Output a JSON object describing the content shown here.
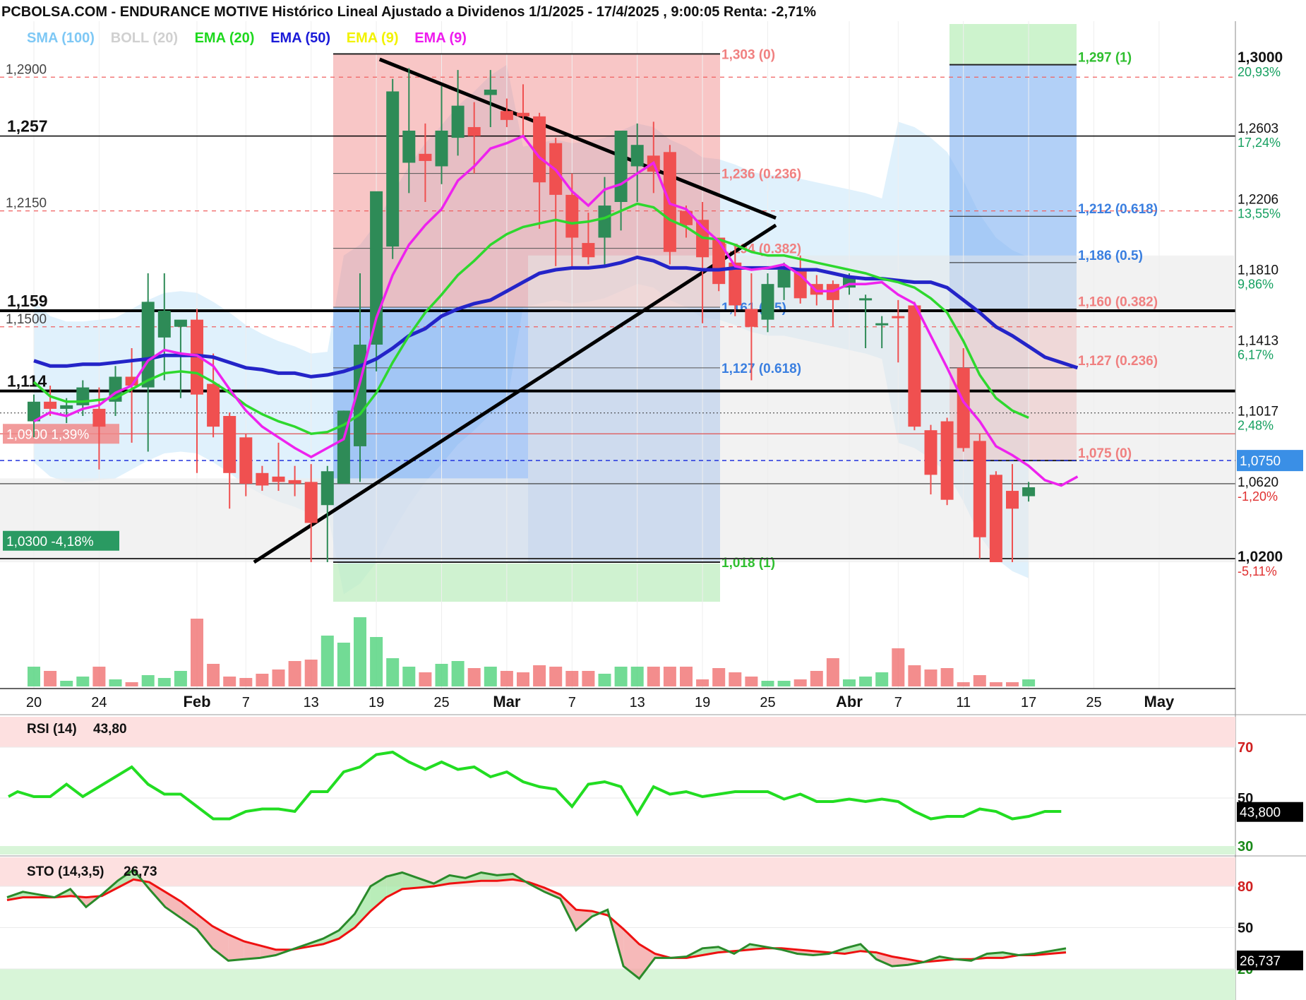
{
  "header": {
    "title": "PCBOLSA.COM - ENDURANCE MOTIVE Histórico Lineal Ajustado a Dividenos 1/1/2025 - 17/4/2025 , 9:00:05 Renta: -2,71%"
  },
  "legend": [
    {
      "label": "SMA (100)",
      "color": "#7ec8f5"
    },
    {
      "label": "BOLL (20)",
      "color": "#d0d0d0"
    },
    {
      "label": "EMA (20)",
      "color": "#1ed81e"
    },
    {
      "label": "EMA (50)",
      "color": "#1a1ad8"
    },
    {
      "label": "EMA (9)",
      "color": "#f2f200"
    },
    {
      "label": "EMA (9)",
      "color": "#ee1aee"
    }
  ],
  "chart_data": [
    {
      "type": "candlestick",
      "title": "ENDURANCE MOTIVE",
      "price_axis": [
        {
          "price": 1.3,
          "label": "1,3000",
          "pct": "20,93%"
        },
        {
          "price": 1.2603,
          "label": "1,2603",
          "pct": "17,24%"
        },
        {
          "price": 1.2206,
          "label": "1,2206",
          "pct": "13,55%"
        },
        {
          "price": 1.181,
          "label": "1,1810",
          "pct": "9,86%"
        },
        {
          "price": 1.1413,
          "label": "1,1413",
          "pct": "6,17%"
        },
        {
          "price": 1.1017,
          "label": "1,1017",
          "pct": "2,48%"
        },
        {
          "price": 1.062,
          "label": "1,0620",
          "pct": "-1,20%"
        },
        {
          "price": 1.02,
          "label": "1,0200",
          "pct": "-5,11%"
        }
      ],
      "current_price": {
        "value": 1.075,
        "label": "1,0750"
      },
      "x_axis": [
        {
          "idx": 0,
          "label": "20"
        },
        {
          "idx": 4,
          "label": "24"
        },
        {
          "idx": 10,
          "label": "Feb",
          "bold": true
        },
        {
          "idx": 13,
          "label": "7"
        },
        {
          "idx": 17,
          "label": "13"
        },
        {
          "idx": 21,
          "label": "19"
        },
        {
          "idx": 25,
          "label": "25"
        },
        {
          "idx": 29,
          "label": "Mar",
          "bold": true
        },
        {
          "idx": 33,
          "label": "7"
        },
        {
          "idx": 37,
          "label": "13"
        },
        {
          "idx": 41,
          "label": "19"
        },
        {
          "idx": 45,
          "label": "25"
        },
        {
          "idx": 50,
          "label": "Abr",
          "bold": true
        },
        {
          "idx": 53,
          "label": "7"
        },
        {
          "idx": 57,
          "label": "11"
        },
        {
          "idx": 61,
          "label": "17"
        },
        {
          "idx": 65,
          "label": "25"
        },
        {
          "idx": 69,
          "label": "May",
          "bold": true
        }
      ],
      "candles": [
        {
          "o": 1.097,
          "h": 1.112,
          "l": 1.088,
          "c": 1.108
        },
        {
          "o": 1.108,
          "h": 1.117,
          "l": 1.1,
          "c": 1.104
        },
        {
          "o": 1.104,
          "h": 1.11,
          "l": 1.096,
          "c": 1.106
        },
        {
          "o": 1.106,
          "h": 1.12,
          "l": 1.1,
          "c": 1.116
        },
        {
          "o": 1.104,
          "h": 1.116,
          "l": 1.07,
          "c": 1.094
        },
        {
          "o": 1.108,
          "h": 1.128,
          "l": 1.1,
          "c": 1.122
        },
        {
          "o": 1.122,
          "h": 1.138,
          "l": 1.085,
          "c": 1.117
        },
        {
          "o": 1.116,
          "h": 1.18,
          "l": 1.08,
          "c": 1.164
        },
        {
          "o": 1.144,
          "h": 1.18,
          "l": 1.12,
          "c": 1.159
        },
        {
          "o": 1.15,
          "h": 1.152,
          "l": 1.11,
          "c": 1.154
        },
        {
          "o": 1.154,
          "h": 1.16,
          "l": 1.068,
          "c": 1.112
        },
        {
          "o": 1.118,
          "h": 1.135,
          "l": 1.088,
          "c": 1.094
        },
        {
          "o": 1.1,
          "h": 1.102,
          "l": 1.048,
          "c": 1.068
        },
        {
          "o": 1.088,
          "h": 1.09,
          "l": 1.055,
          "c": 1.062
        },
        {
          "o": 1.068,
          "h": 1.072,
          "l": 1.058,
          "c": 1.061
        },
        {
          "o": 1.066,
          "h": 1.085,
          "l": 1.058,
          "c": 1.063
        },
        {
          "o": 1.064,
          "h": 1.072,
          "l": 1.055,
          "c": 1.062
        },
        {
          "o": 1.063,
          "h": 1.073,
          "l": 1.018,
          "c": 1.04
        },
        {
          "o": 1.05,
          "h": 1.072,
          "l": 1.018,
          "c": 1.069
        },
        {
          "o": 1.062,
          "h": 1.103,
          "l": 1.062,
          "c": 1.103
        },
        {
          "o": 1.083,
          "h": 1.18,
          "l": 1.063,
          "c": 1.14
        },
        {
          "o": 1.14,
          "h": 1.21,
          "l": 1.125,
          "c": 1.226
        },
        {
          "o": 1.195,
          "h": 1.289,
          "l": 1.188,
          "c": 1.282
        },
        {
          "o": 1.242,
          "h": 1.295,
          "l": 1.225,
          "c": 1.26
        },
        {
          "o": 1.247,
          "h": 1.264,
          "l": 1.22,
          "c": 1.243
        },
        {
          "o": 1.24,
          "h": 1.285,
          "l": 1.23,
          "c": 1.26
        },
        {
          "o": 1.256,
          "h": 1.294,
          "l": 1.246,
          "c": 1.274
        },
        {
          "o": 1.262,
          "h": 1.276,
          "l": 1.236,
          "c": 1.257
        },
        {
          "o": 1.28,
          "h": 1.294,
          "l": 1.262,
          "c": 1.283
        },
        {
          "o": 1.271,
          "h": 1.278,
          "l": 1.262,
          "c": 1.266
        },
        {
          "o": 1.27,
          "h": 1.286,
          "l": 1.256,
          "c": 1.268
        },
        {
          "o": 1.268,
          "h": 1.27,
          "l": 1.205,
          "c": 1.231
        },
        {
          "o": 1.253,
          "h": 1.256,
          "l": 1.184,
          "c": 1.224
        },
        {
          "o": 1.224,
          "h": 1.236,
          "l": 1.183,
          "c": 1.2
        },
        {
          "o": 1.197,
          "h": 1.214,
          "l": 1.185,
          "c": 1.189
        },
        {
          "o": 1.2,
          "h": 1.234,
          "l": 1.184,
          "c": 1.218
        },
        {
          "o": 1.22,
          "h": 1.242,
          "l": 1.204,
          "c": 1.26
        },
        {
          "o": 1.24,
          "h": 1.264,
          "l": 1.22,
          "c": 1.252
        },
        {
          "o": 1.246,
          "h": 1.265,
          "l": 1.225,
          "c": 1.237
        },
        {
          "o": 1.248,
          "h": 1.252,
          "l": 1.185,
          "c": 1.192
        },
        {
          "o": 1.215,
          "h": 1.218,
          "l": 1.2,
          "c": 1.207
        },
        {
          "o": 1.21,
          "h": 1.22,
          "l": 1.152,
          "c": 1.189
        },
        {
          "o": 1.2,
          "h": 1.2,
          "l": 1.17,
          "c": 1.174
        },
        {
          "o": 1.186,
          "h": 1.196,
          "l": 1.156,
          "c": 1.162
        },
        {
          "o": 1.16,
          "h": 1.18,
          "l": 1.12,
          "c": 1.15
        },
        {
          "o": 1.154,
          "h": 1.18,
          "l": 1.147,
          "c": 1.174
        },
        {
          "o": 1.172,
          "h": 1.186,
          "l": 1.165,
          "c": 1.182
        },
        {
          "o": 1.182,
          "h": 1.19,
          "l": 1.163,
          "c": 1.166
        },
        {
          "o": 1.174,
          "h": 1.179,
          "l": 1.162,
          "c": 1.168
        },
        {
          "o": 1.174,
          "h": 1.176,
          "l": 1.15,
          "c": 1.165
        },
        {
          "o": 1.172,
          "h": 1.18,
          "l": 1.168,
          "c": 1.178
        },
        {
          "o": 1.165,
          "h": 1.168,
          "l": 1.138,
          "c": 1.166
        },
        {
          "o": 1.152,
          "h": 1.156,
          "l": 1.138,
          "c": 1.152
        },
        {
          "o": 1.156,
          "h": 1.165,
          "l": 1.13,
          "c": 1.155
        },
        {
          "o": 1.162,
          "h": 1.164,
          "l": 1.092,
          "c": 1.094
        },
        {
          "o": 1.092,
          "h": 1.095,
          "l": 1.056,
          "c": 1.067
        },
        {
          "o": 1.097,
          "h": 1.099,
          "l": 1.05,
          "c": 1.053
        },
        {
          "o": 1.127,
          "h": 1.138,
          "l": 1.08,
          "c": 1.082
        },
        {
          "o": 1.086,
          "h": 1.09,
          "l": 1.02,
          "c": 1.032
        },
        {
          "o": 1.067,
          "h": 1.069,
          "l": 1.018,
          "c": 1.018
        },
        {
          "o": 1.058,
          "h": 1.073,
          "l": 1.018,
          "c": 1.048
        },
        {
          "o": 1.055,
          "h": 1.063,
          "l": 1.052,
          "c": 1.06
        }
      ],
      "volumes": [
        28,
        22,
        8,
        14,
        28,
        10,
        6,
        16,
        12,
        22,
        96,
        32,
        14,
        12,
        18,
        24,
        36,
        38,
        72,
        62,
        98,
        70,
        40,
        28,
        20,
        32,
        36,
        26,
        28,
        22,
        20,
        30,
        28,
        22,
        22,
        18,
        28,
        28,
        28,
        28,
        28,
        10,
        26,
        20,
        14,
        8,
        8,
        10,
        22,
        40,
        10,
        14,
        20,
        54,
        30,
        24,
        26,
        6,
        16,
        6,
        6,
        10
      ],
      "ema20": [
        1.119,
        1.111,
        1.108,
        1.108,
        1.109,
        1.11,
        1.115,
        1.12,
        1.124,
        1.125,
        1.124,
        1.119,
        1.113,
        1.106,
        1.101,
        1.097,
        1.094,
        1.09,
        1.091,
        1.095,
        1.101,
        1.113,
        1.13,
        1.145,
        1.158,
        1.168,
        1.179,
        1.187,
        1.196,
        1.202,
        1.206,
        1.208,
        1.21,
        1.208,
        1.209,
        1.211,
        1.215,
        1.219,
        1.217,
        1.21,
        1.206,
        1.2,
        1.199,
        1.196,
        1.192,
        1.19,
        1.19,
        1.188,
        1.186,
        1.184,
        1.182,
        1.18,
        1.177,
        1.175,
        1.172,
        1.166,
        1.158,
        1.142,
        1.123,
        1.11,
        1.103,
        1.099
      ],
      "ema50": [
        1.131,
        1.128,
        1.128,
        1.129,
        1.129,
        1.13,
        1.131,
        1.132,
        1.134,
        1.134,
        1.134,
        1.133,
        1.13,
        1.127,
        1.126,
        1.124,
        1.124,
        1.122,
        1.123,
        1.125,
        1.128,
        1.132,
        1.138,
        1.145,
        1.149,
        1.156,
        1.16,
        1.163,
        1.165,
        1.17,
        1.175,
        1.18,
        1.182,
        1.183,
        1.183,
        1.184,
        1.186,
        1.189,
        1.187,
        1.183,
        1.183,
        1.182,
        1.182,
        1.183,
        1.183,
        1.183,
        1.183,
        1.182,
        1.182,
        1.18,
        1.178,
        1.177,
        1.177,
        1.176,
        1.175,
        1.175,
        1.172,
        1.165,
        1.158,
        1.15,
        1.145,
        1.139,
        1.133,
        1.13,
        1.127
      ],
      "ema9": [
        1.097,
        1.102,
        1.1,
        1.104,
        1.106,
        1.113,
        1.117,
        1.131,
        1.137,
        1.135,
        1.134,
        1.128,
        1.115,
        1.103,
        1.094,
        1.088,
        1.082,
        1.077,
        1.082,
        1.087,
        1.119,
        1.155,
        1.179,
        1.196,
        1.207,
        1.216,
        1.232,
        1.24,
        1.25,
        1.253,
        1.257,
        1.245,
        1.238,
        1.226,
        1.218,
        1.227,
        1.23,
        1.236,
        1.242,
        1.219,
        1.216,
        1.206,
        1.198,
        1.184,
        1.182,
        1.183,
        1.185,
        1.179,
        1.17,
        1.17,
        1.174,
        1.174,
        1.175,
        1.168,
        1.163,
        1.145,
        1.127,
        1.108,
        1.097,
        1.083,
        1.078,
        1.072,
        1.064,
        1.061,
        1.066
      ],
      "horizontal_levels": [
        {
          "price": 1.257,
          "label": "1,257"
        },
        {
          "price": 1.159,
          "label": "1,159"
        },
        {
          "price": 1.114,
          "label": "1,114"
        }
      ],
      "dashed_levels": [
        {
          "price": 1.29,
          "label": "1,2900"
        },
        {
          "price": 1.215,
          "label": "1,2150"
        },
        {
          "price": 1.15,
          "label": "1,1500"
        }
      ],
      "tags": [
        {
          "price": 1.09,
          "label": "1,0900  1,39%"
        },
        {
          "price": 1.03,
          "label": "1,0300  -4,18%"
        }
      ],
      "fib_left": [
        {
          "price": 1.303,
          "label": "1,303 (0)"
        },
        {
          "price": 1.236,
          "label": "1,236 (0.236)"
        },
        {
          "price": 1.194,
          "label": "1,194 (0.382)"
        },
        {
          "price": 1.161,
          "label": "1,161 (0.5)"
        },
        {
          "price": 1.127,
          "label": "1,127 (0.618)"
        },
        {
          "price": 1.018,
          "label": "1,018 (1)"
        }
      ],
      "fib_right": [
        {
          "price": 1.297,
          "label": "1,297 (1)"
        },
        {
          "price": 1.212,
          "label": "1,212 (0.618)"
        },
        {
          "price": 1.186,
          "label": "1,186 (0.5)"
        },
        {
          "price": 1.16,
          "label": "1,160 (0.382)"
        },
        {
          "price": 1.127,
          "label": "1,127 (0.236)"
        },
        {
          "price": 1.075,
          "label": "1,075 (0)"
        }
      ]
    },
    {
      "type": "line",
      "title": "RSI (14)",
      "last_value": "43,80",
      "last_tag": "43,800",
      "ticks": [
        {
          "v": 70,
          "label": "70"
        },
        {
          "v": 50,
          "label": "50"
        },
        {
          "v": 30,
          "label": "30"
        }
      ],
      "values": [
        50,
        52,
        50,
        50,
        55,
        50,
        54,
        58,
        62,
        55,
        51,
        51,
        46,
        41,
        41,
        44,
        45,
        45,
        44,
        52,
        52,
        60,
        62,
        67,
        68,
        64,
        61,
        64,
        61,
        62,
        58,
        60,
        56,
        54,
        53,
        46,
        55,
        56,
        54,
        43,
        54,
        51,
        52,
        50,
        51,
        52,
        52,
        52,
        49,
        51,
        48,
        48,
        49,
        48,
        49,
        48,
        44,
        41,
        42,
        42,
        45,
        44,
        41,
        42,
        44,
        44
      ]
    },
    {
      "type": "line",
      "title": "STO (14,3,5)",
      "last_value": "26,73",
      "last_tag": "26,737",
      "ticks": [
        {
          "v": 80,
          "label": "80"
        },
        {
          "v": 50,
          "label": "50"
        },
        {
          "v": 20,
          "label": "20"
        }
      ],
      "k": [
        72,
        76,
        74,
        72,
        78,
        65,
        74,
        84,
        92,
        78,
        65,
        57,
        49,
        35,
        26,
        27,
        28,
        30,
        34,
        38,
        42,
        48,
        60,
        80,
        87,
        90,
        86,
        82,
        88,
        86,
        90,
        88,
        89,
        82,
        76,
        71,
        48,
        58,
        63,
        22,
        13,
        28,
        28,
        29,
        35,
        36,
        31,
        38,
        36,
        34,
        31,
        30,
        31,
        35,
        38,
        27,
        22,
        23,
        25,
        29,
        27,
        26,
        31,
        32,
        30,
        31,
        33,
        35
      ],
      "d": [
        70,
        72,
        72,
        72,
        73,
        72,
        73,
        79,
        85,
        83,
        76,
        69,
        60,
        51,
        45,
        40,
        37,
        34,
        34,
        36,
        38,
        42,
        50,
        62,
        72,
        78,
        79,
        80,
        82,
        83,
        84,
        84,
        85,
        83,
        79,
        74,
        63,
        62,
        59,
        49,
        38,
        31,
        28,
        28,
        30,
        32,
        33,
        34,
        35,
        35,
        34,
        33,
        32,
        31,
        33,
        32,
        29,
        27,
        25,
        26,
        27,
        27,
        28,
        28,
        30,
        30,
        31,
        32
      ]
    }
  ]
}
